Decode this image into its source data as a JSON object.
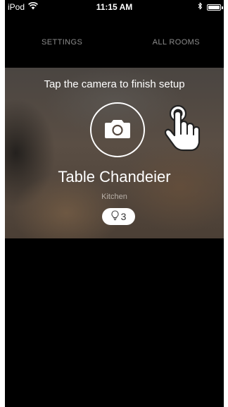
{
  "status_bar": {
    "carrier": "iPod",
    "time": "11:15 AM",
    "icons": [
      "wifi-icon",
      "bluetooth-icon",
      "battery-icon"
    ]
  },
  "nav": {
    "settings_label": "SETTINGS",
    "all_rooms_label": "ALL ROOMS"
  },
  "hero": {
    "instruction": "Tap the camera to finish setup",
    "light_name": "Table Chandeier",
    "room_name": "Kitchen",
    "bulb_count": "3"
  },
  "colors": {
    "background": "#000000",
    "nav_text": "#8c8c8c",
    "accent": "#ffffff"
  }
}
